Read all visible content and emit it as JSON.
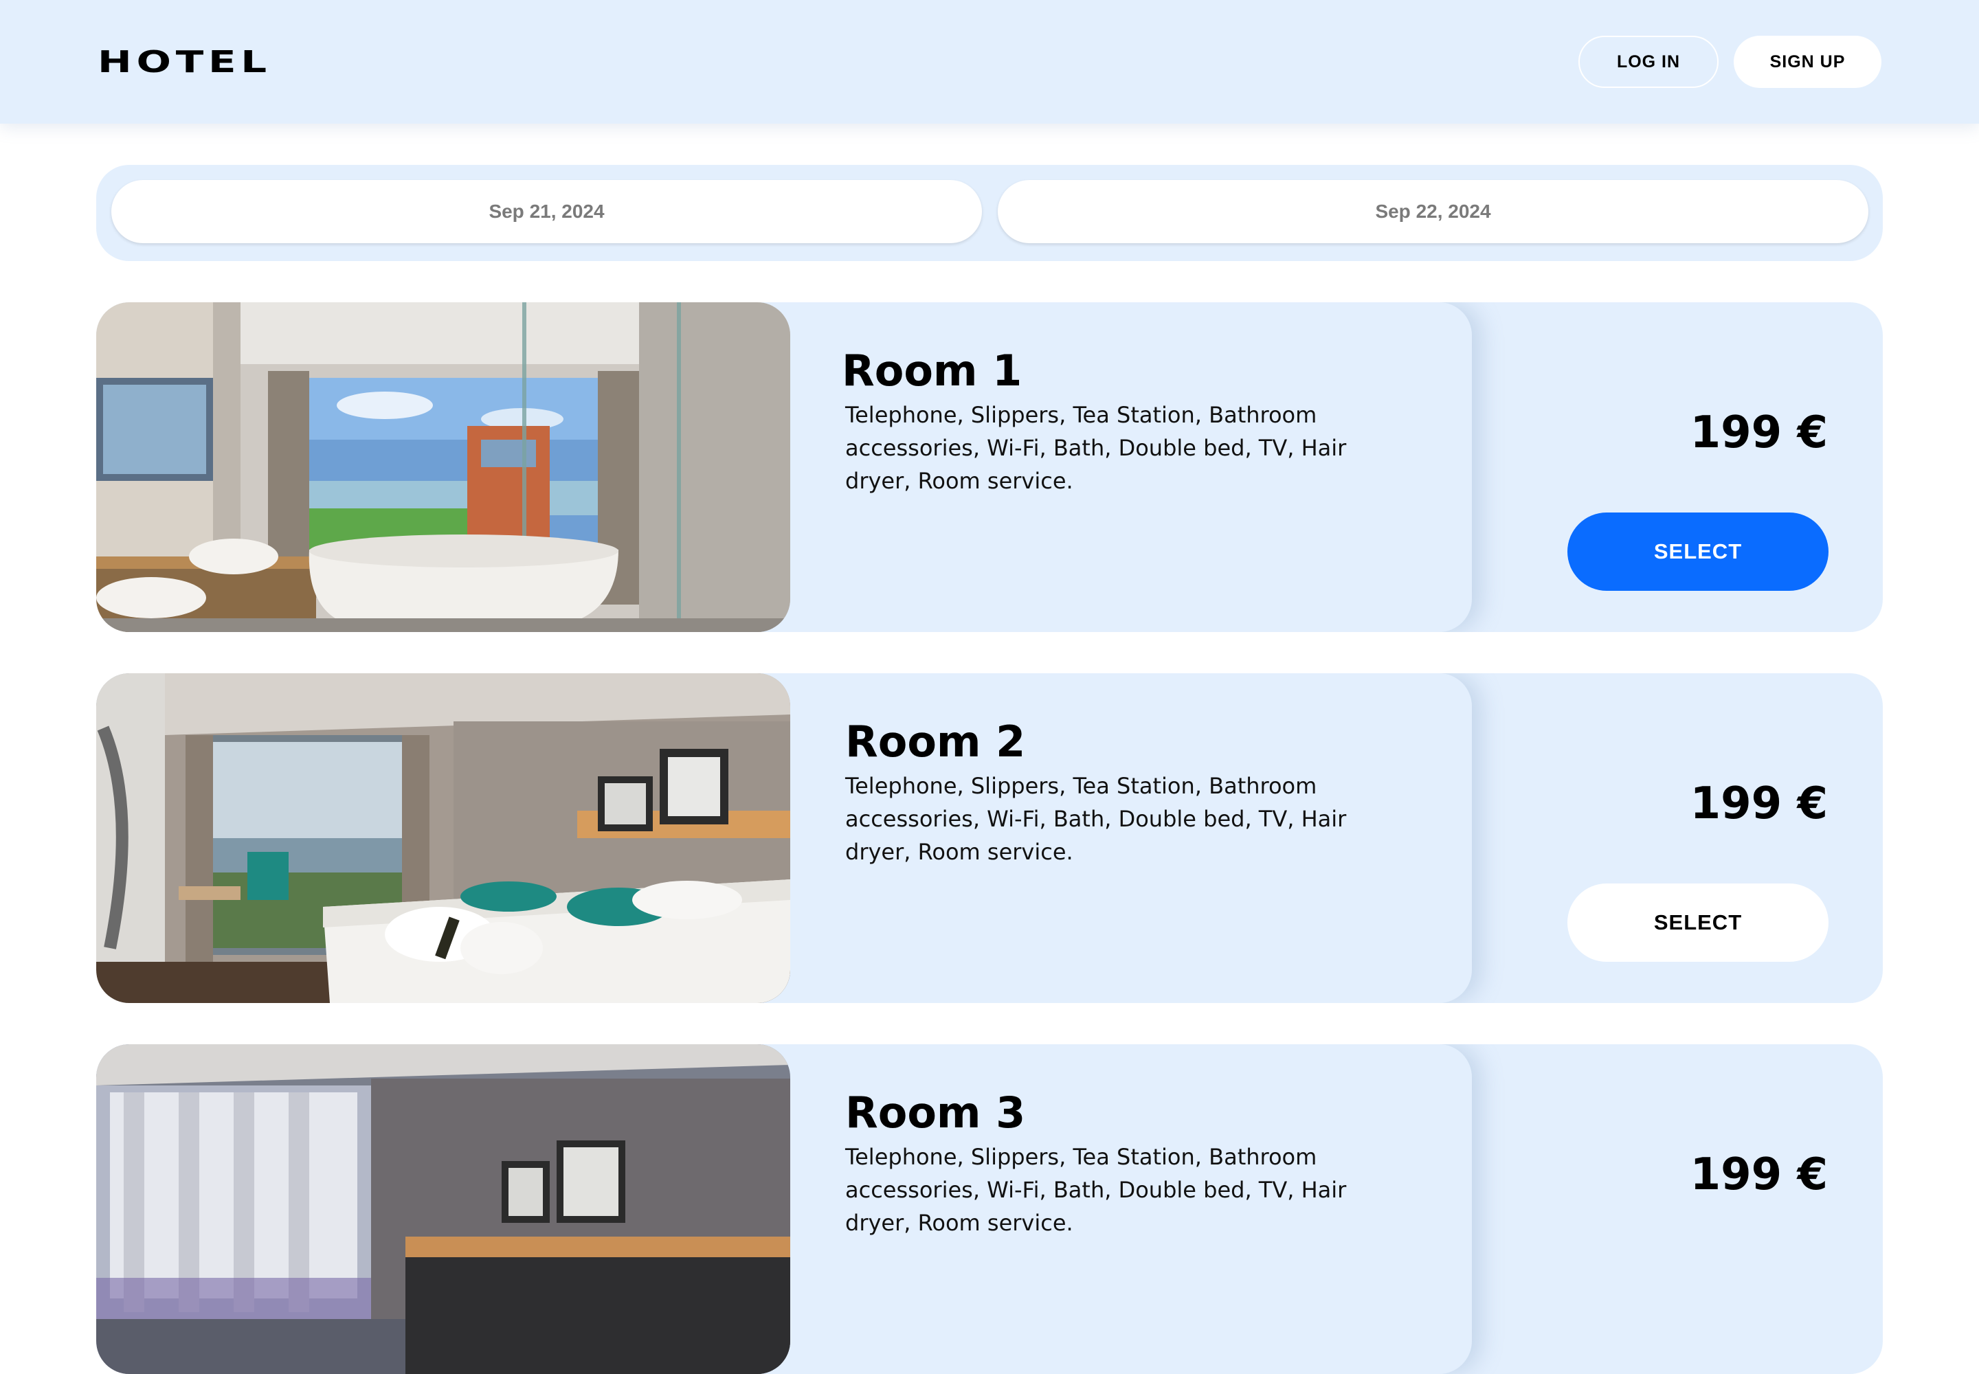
{
  "header": {
    "logo": "HOTEL",
    "login_label": "LOG IN",
    "signup_label": "SIGN UP"
  },
  "dates": {
    "check_in": "Sep 21, 2024",
    "check_out": "Sep 22, 2024"
  },
  "rooms": [
    {
      "title": "Room 1",
      "amenities": "Telephone, Slippers, Tea Station, Bathroom accessories, Wi-Fi, Bath, Double bed, TV, Hair dryer, Room service.",
      "price": "199 €",
      "select_label": "SELECT",
      "selected": true,
      "photo": "bathroom-with-freestanding-tub"
    },
    {
      "title": "Room 2",
      "amenities": "Telephone, Slippers, Tea Station, Bathroom accessories, Wi-Fi, Bath, Double bed, TV, Hair dryer, Room service.",
      "price": "199 €",
      "select_label": "SELECT",
      "selected": false,
      "photo": "bedroom-with-sea-view"
    },
    {
      "title": "Room 3",
      "amenities": "Telephone, Slippers, Tea Station, Bathroom accessories, Wi-Fi, Bath, Double bed, TV, Hair dryer, Room service.",
      "price": "199 €",
      "photo": "bedroom-with-curtains"
    }
  ],
  "colors": {
    "header_bg": "#e3effd",
    "card_bg": "#e3effd",
    "accent": "#0a6cff",
    "date_text": "#7a7a7a"
  }
}
